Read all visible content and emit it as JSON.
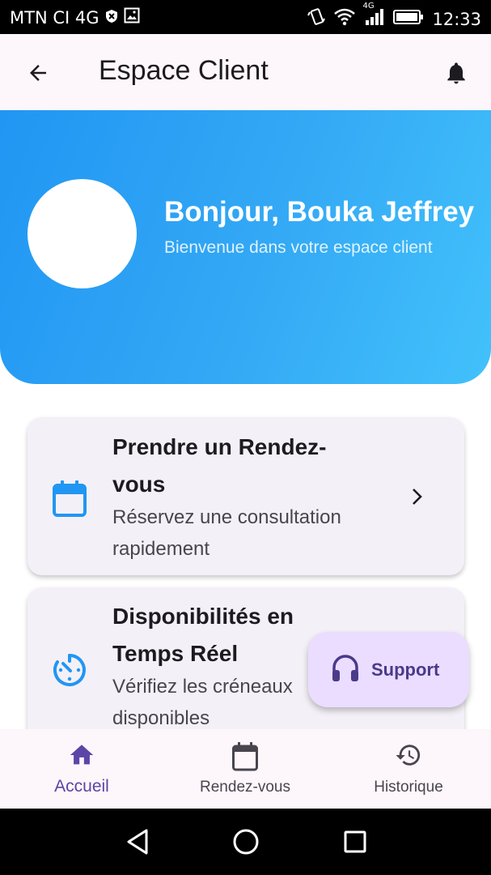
{
  "status_bar": {
    "carrier": "MTN CI 4G",
    "time": "12:33",
    "network_type": "4G"
  },
  "app_bar": {
    "title": "Espace Client"
  },
  "hero": {
    "greeting": "Bonjour, Bouka Jeffrey",
    "subtitle": "Bienvenue dans votre espace client"
  },
  "cards": [
    {
      "title": "Prendre un Rendez-vous",
      "description": "Réservez une consultation rapidement",
      "icon": "calendar-icon"
    },
    {
      "title": "Disponibilités en Temps Réel",
      "description": "Vérifiez les créneaux disponibles",
      "icon": "timer-icon"
    }
  ],
  "support": {
    "label": "Support",
    "icon": "headset-icon"
  },
  "bottom_nav": [
    {
      "label": "Accueil",
      "icon": "home-icon",
      "active": true
    },
    {
      "label": "Rendez-vous",
      "icon": "calendar-icon",
      "active": false
    },
    {
      "label": "Historique",
      "icon": "history-icon",
      "active": false
    }
  ],
  "colors": {
    "accent": "#2196f3",
    "hero_end": "#42c1fb",
    "nav_active": "#5c45a6",
    "support_bg": "#eaddff"
  }
}
